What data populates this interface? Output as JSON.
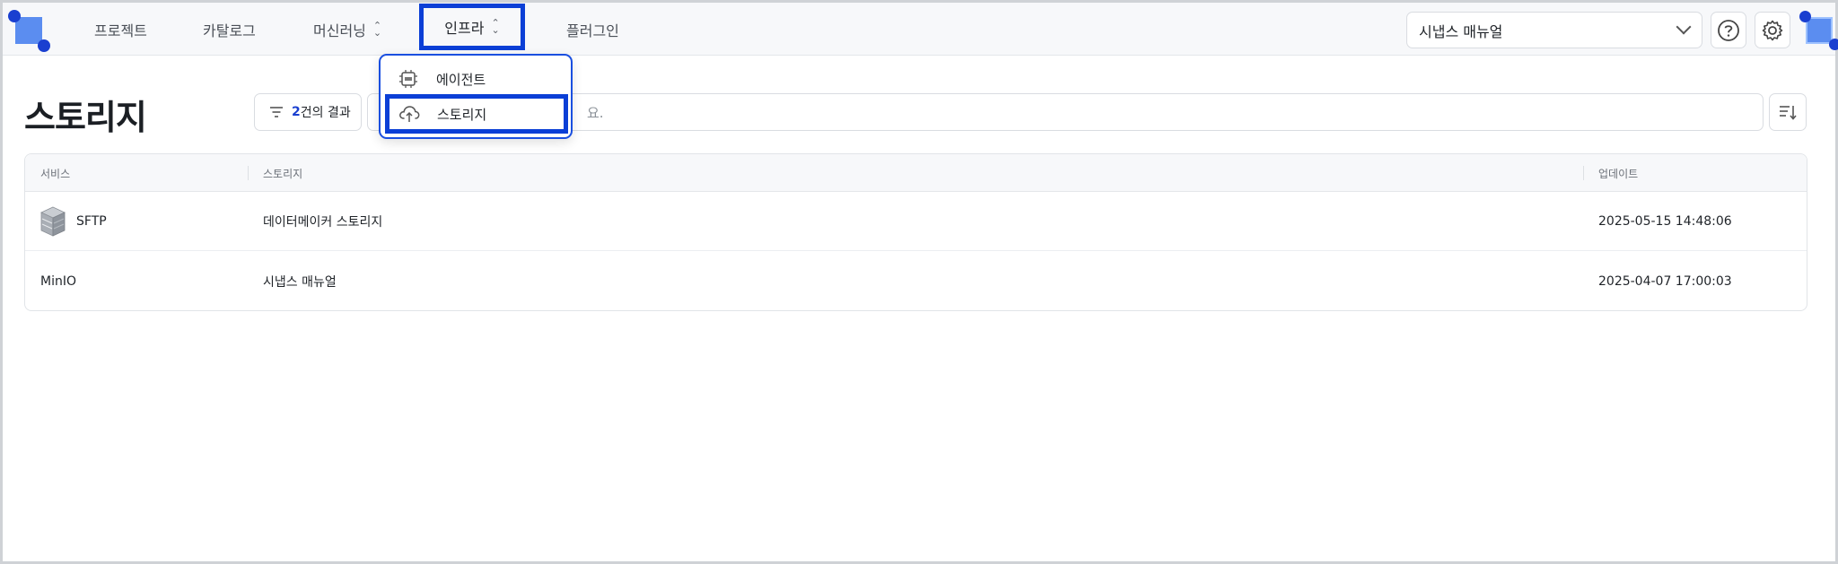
{
  "nav": {
    "items": [
      "프로젝트",
      "카탈로그",
      "머신러닝",
      "인프라",
      "플러그인"
    ],
    "active": "인프라"
  },
  "workspace": {
    "selected": "시냅스 매뉴얼"
  },
  "header_icons": [
    "help-icon",
    "gear-icon"
  ],
  "dropdown": {
    "items": [
      {
        "label": "에이전트",
        "icon": "gpu-chip-icon"
      },
      {
        "label": "스토리지",
        "icon": "cloud-upload-icon"
      }
    ],
    "selected": "스토리지"
  },
  "page": {
    "title": "스토리지",
    "filter_count": "2",
    "filter_suffix": "건의 결과",
    "search_placeholder_visible": "요."
  },
  "table": {
    "columns": [
      "서비스",
      "스토리지",
      "업데이트"
    ],
    "rows": [
      {
        "service": "SFTP",
        "storage": "데이터메이커 스토리지",
        "updated": "2025-05-15 14:48:06"
      },
      {
        "service": "MinIO",
        "storage": "시냅스 매뉴얼",
        "updated": "2025-04-07 17:00:03"
      }
    ]
  },
  "colors": {
    "accent": "#0b3fd6",
    "brand": "#5b8df0"
  }
}
